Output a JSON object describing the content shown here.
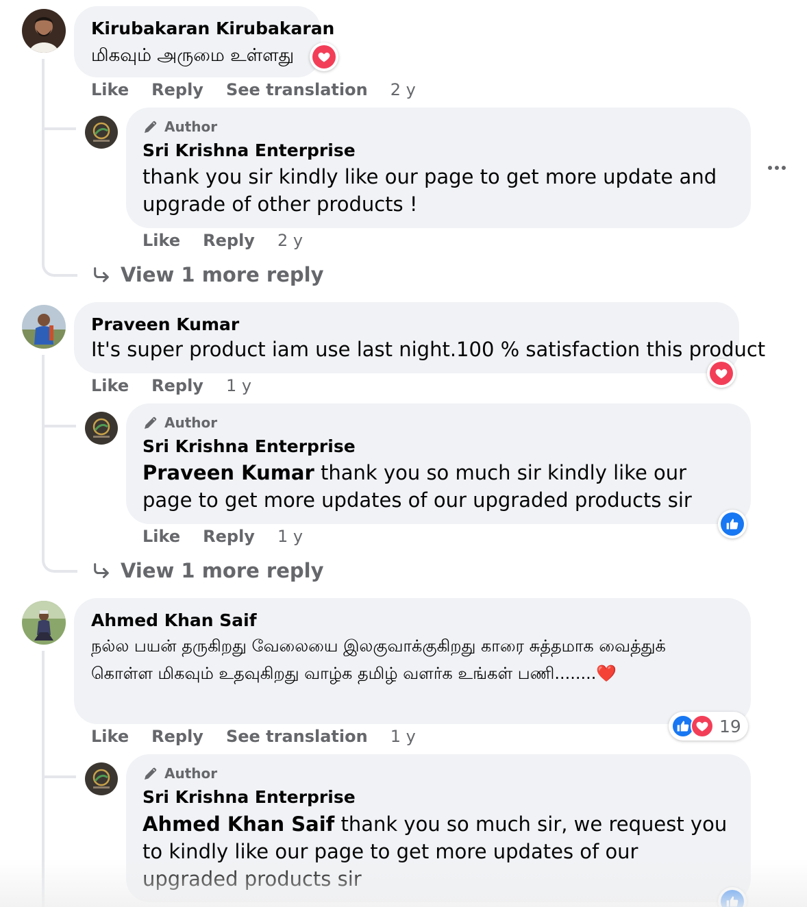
{
  "comments": [
    {
      "author": "Kirubakaran Kirubakaran",
      "text": "மிகவும் அருமை உள்ளது",
      "reaction": "love",
      "actions": {
        "like": "Like",
        "reply": "Reply",
        "translate": "See translation",
        "time": "2 y"
      },
      "reply": {
        "badge": "Author",
        "author": "Sri Krishna Enterprise",
        "text": "thank you sir kindly like our page to get more update and upgrade of other products !",
        "actions": {
          "like": "Like",
          "reply": "Reply",
          "time": "2 y"
        }
      },
      "view_more": "View 1 more reply"
    },
    {
      "author": "Praveen Kumar",
      "text": "It's super product iam use last night.100 % satisfaction this product",
      "reaction": "love",
      "actions": {
        "like": "Like",
        "reply": "Reply",
        "time": "1 y"
      },
      "reply": {
        "badge": "Author",
        "author": "Sri Krishna Enterprise",
        "mention": "Praveen Kumar",
        "text": " thank you so much sir kindly like our page to get more updates of our upgraded products sir",
        "reaction": "like",
        "actions": {
          "like": "Like",
          "reply": "Reply",
          "time": "1 y"
        }
      },
      "view_more": "View 1 more reply"
    },
    {
      "author": "Ahmed Khan Saif",
      "text": "நல்ல பயன் தருகிறது வேலையை இலகுவாக்குகிறது காரை சுத்தமாக வைத்துக் கொள்ள மிகவும் உதவுகிறது வாழ்க தமிழ் வளர்க உங்கள் பணி........❤️",
      "reaction_count": "19",
      "actions": {
        "like": "Like",
        "reply": "Reply",
        "translate": "See translation",
        "time": "1 y"
      },
      "reply": {
        "badge": "Author",
        "author": "Sri Krishna Enterprise",
        "mention": "Ahmed Khan Saif",
        "text": " thank you so much sir, we request you to kindly like our page to get more updates of our upgraded products sir",
        "reaction": "like"
      }
    }
  ],
  "colors": {
    "bubble": "#f0f2f5",
    "secondary_text": "#65676b",
    "love": "#f33e58",
    "like": "#1877f2"
  },
  "icons": {
    "author_badge": "pen-icon",
    "view_more": "reply-arrow-icon",
    "menu": "more-horizontal-icon"
  }
}
